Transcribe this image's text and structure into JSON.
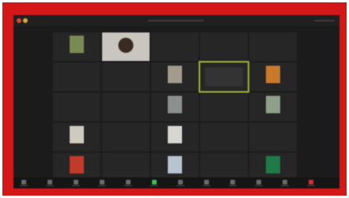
{
  "meeting": {
    "tiles": [
      {
        "name": "",
        "tag": "",
        "kind": "photo",
        "color": "#7a8a55"
      },
      {
        "name": "",
        "tag": "",
        "kind": "video",
        "color": "#c9c6c0"
      },
      {
        "name": "",
        "tag": "",
        "kind": "text"
      },
      {
        "name": "",
        "tag": "",
        "kind": "text"
      },
      {
        "name": "",
        "tag": "",
        "kind": "text"
      },
      {
        "name": "",
        "tag": "",
        "kind": "text"
      },
      {
        "name": "",
        "tag": "",
        "kind": "text"
      },
      {
        "name": "",
        "tag": "",
        "kind": "photo",
        "color": "#a39b8c"
      },
      {
        "name": "",
        "tag": "",
        "kind": "speaking"
      },
      {
        "name": "",
        "tag": "",
        "kind": "photo",
        "color": "#c77a2c"
      },
      {
        "name": "",
        "tag": "",
        "kind": "text"
      },
      {
        "name": "",
        "tag": "",
        "kind": "text"
      },
      {
        "name": "",
        "tag": "",
        "kind": "photo",
        "color": "#8b8f8e"
      },
      {
        "name": "",
        "tag": "",
        "kind": "text"
      },
      {
        "name": "",
        "tag": "",
        "kind": "photo",
        "color": "#8fa08a"
      },
      {
        "name": "",
        "tag": "",
        "kind": "photo",
        "color": "#cfcac0"
      },
      {
        "name": "",
        "tag": "",
        "kind": "text"
      },
      {
        "name": "",
        "tag": "",
        "kind": "photo",
        "color": "#d8d6d2"
      },
      {
        "name": "",
        "tag": "",
        "kind": "text"
      },
      {
        "name": "",
        "tag": "",
        "kind": "text"
      },
      {
        "name": "",
        "tag": "",
        "kind": "photo",
        "color": "#c23a2a"
      },
      {
        "name": "",
        "tag": "",
        "kind": "text"
      },
      {
        "name": "",
        "tag": "",
        "kind": "photo",
        "color": "#b8c4cf"
      },
      {
        "name": "",
        "tag": "",
        "kind": "text"
      },
      {
        "name": "",
        "tag": "",
        "kind": "photo",
        "color": "#1f7a48"
      }
    ]
  },
  "colors": {
    "frame": "#d41818",
    "screen": "#1b1b1b",
    "tile": "#262626",
    "speaking_outline": "#9fb13a",
    "end_button": "#d03030"
  },
  "toolbar": {
    "buttons": [
      {
        "icon": "mic-icon"
      },
      {
        "icon": "video-icon"
      },
      {
        "icon": "security-icon"
      },
      {
        "icon": "participants-icon"
      },
      {
        "icon": "chat-icon"
      },
      {
        "icon": "share-screen-icon"
      },
      {
        "icon": "record-icon"
      },
      {
        "icon": "reactions-icon"
      },
      {
        "icon": "apps-icon"
      },
      {
        "icon": "whiteboard-icon"
      },
      {
        "icon": "more-icon"
      },
      {
        "icon": "end-icon"
      }
    ]
  }
}
